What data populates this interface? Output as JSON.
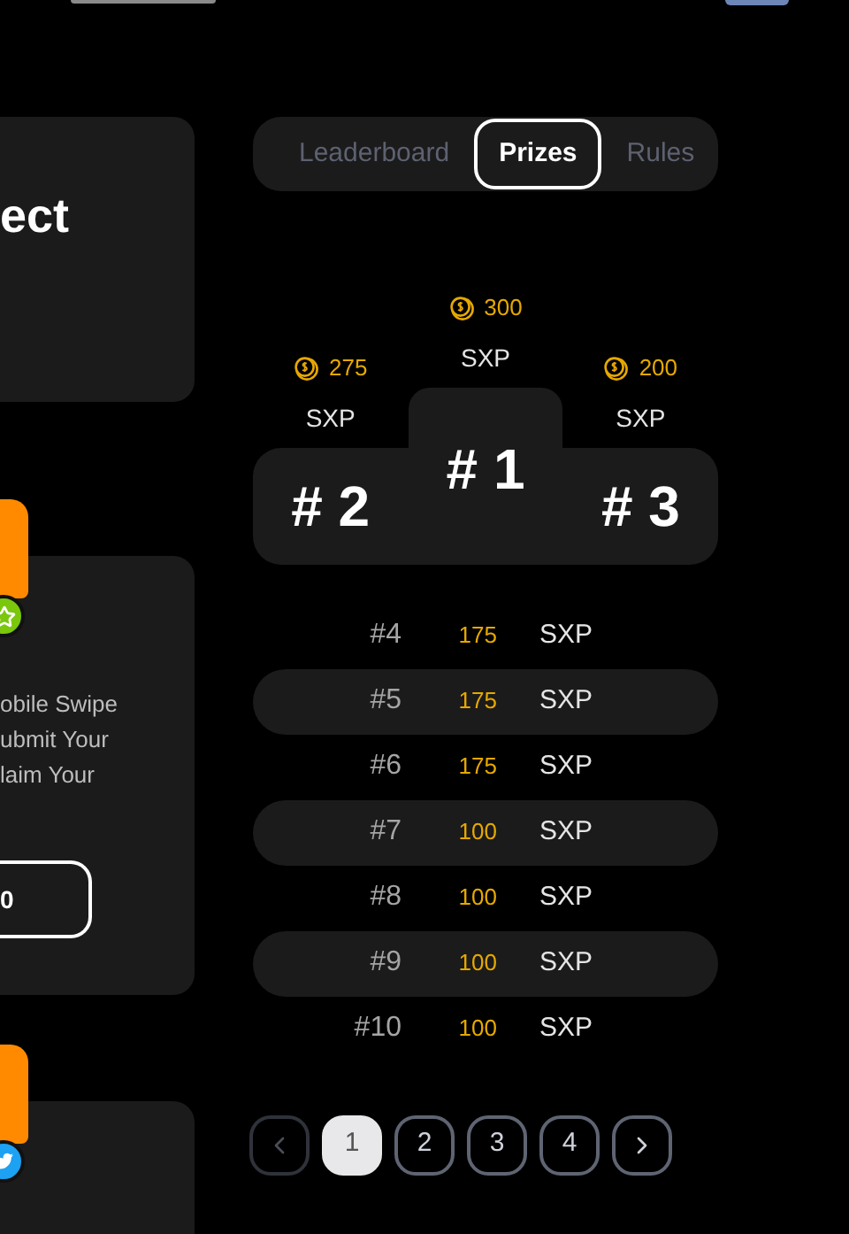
{
  "left_cards": [
    {
      "kind": "title",
      "title": "ect"
    },
    {
      "kind": "task",
      "badge": {
        "kind": "star"
      },
      "description_lines": [
        "obile Swipe",
        "ubmit Your",
        "laim Your"
      ],
      "button": "0"
    },
    {
      "kind": "task",
      "badge": {
        "kind": "bird"
      }
    }
  ],
  "tabs": [
    {
      "label": "Leaderboard",
      "selected": false
    },
    {
      "label": "Prizes",
      "selected": true
    },
    {
      "label": "Rules",
      "selected": false
    }
  ],
  "podium": [
    {
      "rank": "# 2",
      "amount": "275",
      "currency": "SXP",
      "kind": "left"
    },
    {
      "rank": "# 1",
      "amount": "300",
      "currency": "SXP",
      "kind": "center"
    },
    {
      "rank": "# 3",
      "amount": "200",
      "currency": "SXP",
      "kind": "right"
    }
  ],
  "prize_rows": [
    {
      "rank": "#4",
      "amount": "175",
      "currency": "SXP"
    },
    {
      "rank": "#5",
      "amount": "175",
      "currency": "SXP"
    },
    {
      "rank": "#6",
      "amount": "175",
      "currency": "SXP"
    },
    {
      "rank": "#7",
      "amount": "100",
      "currency": "SXP"
    },
    {
      "rank": "#8",
      "amount": "100",
      "currency": "SXP"
    },
    {
      "rank": "#9",
      "amount": "100",
      "currency": "SXP"
    },
    {
      "rank": "#10",
      "amount": "100",
      "currency": "SXP"
    }
  ],
  "pagination": {
    "prev_disabled": true,
    "pages": [
      {
        "label": "1",
        "selected": true
      },
      {
        "label": "2",
        "selected": false
      },
      {
        "label": "3",
        "selected": false
      },
      {
        "label": "4",
        "selected": false
      }
    ],
    "next_disabled": false
  }
}
